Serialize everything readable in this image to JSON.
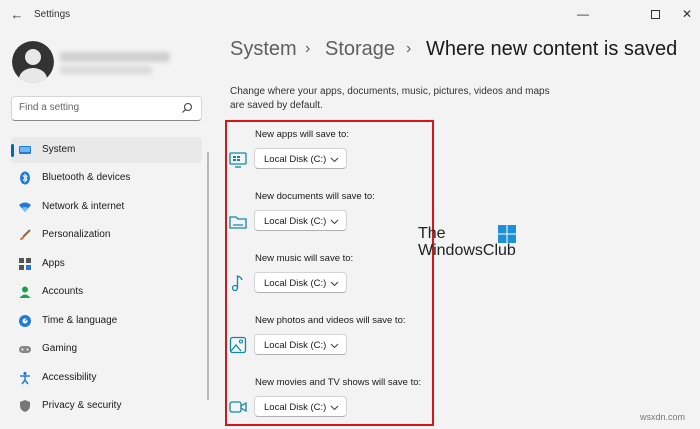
{
  "window": {
    "title": "Settings",
    "back_glyph": "←",
    "minimize_glyph": "—",
    "close_glyph": "✕"
  },
  "search": {
    "placeholder": "Find a setting"
  },
  "sidebar": {
    "items": [
      {
        "label": "System",
        "icon": "monitor-icon",
        "active": true
      },
      {
        "label": "Bluetooth & devices",
        "icon": "bluetooth-icon"
      },
      {
        "label": "Network & internet",
        "icon": "wifi-icon"
      },
      {
        "label": "Personalization",
        "icon": "brush-icon"
      },
      {
        "label": "Apps",
        "icon": "apps-icon"
      },
      {
        "label": "Accounts",
        "icon": "person-icon"
      },
      {
        "label": "Time & language",
        "icon": "globe-icon"
      },
      {
        "label": "Gaming",
        "icon": "gamepad-icon"
      },
      {
        "label": "Accessibility",
        "icon": "accessibility-icon"
      },
      {
        "label": "Privacy & security",
        "icon": "shield-icon"
      }
    ]
  },
  "breadcrumb": {
    "part1": "System",
    "part2": "Storage",
    "current": "Where new content is saved",
    "separator": "›"
  },
  "main": {
    "description": "Change where your apps, documents, music, pictures, videos and maps are saved by default.",
    "rows": [
      {
        "label": "New apps will save to:",
        "value": "Local Disk (C:)",
        "icon": "apps-monitor-icon"
      },
      {
        "label": "New documents will save to:",
        "value": "Local Disk (C:)",
        "icon": "folder-icon"
      },
      {
        "label": "New music will save to:",
        "value": "Local Disk (C:)",
        "icon": "music-note-icon"
      },
      {
        "label": "New photos and videos will save to:",
        "value": "Local Disk (C:)",
        "icon": "photo-icon"
      },
      {
        "label": "New movies and TV shows will save to:",
        "value": "Local Disk (C:)",
        "icon": "video-camera-icon"
      }
    ]
  },
  "watermark": {
    "line1": "The",
    "line2": "WindowsClub",
    "site": "wsxdn.com"
  },
  "colors": {
    "accent": "#0067c0",
    "icon_teal": "#0f8aa6",
    "highlight": "#d7141a"
  }
}
